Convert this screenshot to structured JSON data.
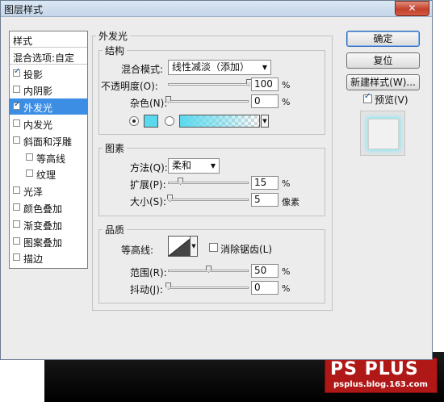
{
  "window": {
    "title": "图层样式",
    "close_icon": "close-icon"
  },
  "style_list": {
    "header": "样式",
    "blend_options": "混合选项:自定",
    "items": [
      {
        "label": "投影",
        "checked": true
      },
      {
        "label": "内阴影",
        "checked": false
      },
      {
        "label": "外发光",
        "checked": true,
        "selected": true
      },
      {
        "label": "内发光",
        "checked": false
      },
      {
        "label": "斜面和浮雕",
        "checked": false
      },
      {
        "label": "等高线",
        "checked": false,
        "indent": true
      },
      {
        "label": "纹理",
        "checked": false,
        "indent": true
      },
      {
        "label": "光泽",
        "checked": false
      },
      {
        "label": "颜色叠加",
        "checked": false
      },
      {
        "label": "渐变叠加",
        "checked": false
      },
      {
        "label": "图案叠加",
        "checked": false
      },
      {
        "label": "描边",
        "checked": false
      }
    ]
  },
  "outer_glow": {
    "title": "外发光",
    "structure": {
      "title": "结构",
      "blend_mode_label": "混合模式:",
      "blend_mode_value": "线性减淡（添加）",
      "opacity_label": "不透明度(O):",
      "opacity_value": "100",
      "opacity_level": 1.0,
      "noise_label": "杂色(N):",
      "noise_value": "0",
      "noise_level": 0.0,
      "percent": "%",
      "glow_color": "#5ad9ee"
    },
    "elements": {
      "title": "图素",
      "technique_label": "方法(Q):",
      "technique_value": "柔和",
      "spread_label": "扩展(P):",
      "spread_value": "15",
      "spread_level": 0.15,
      "size_label": "大小(S):",
      "size_value": "5",
      "size_unit": "像素",
      "size_level": 0.02,
      "percent": "%"
    },
    "quality": {
      "title": "品质",
      "contour_label": "等高线:",
      "anti_alias_label": "消除锯齿(L)",
      "anti_alias_checked": false,
      "range_label": "范围(R):",
      "range_value": "50",
      "range_level": 0.5,
      "jitter_label": "抖动(J):",
      "jitter_value": "0",
      "jitter_level": 0.0,
      "percent": "%"
    }
  },
  "buttons": {
    "ok": "确定",
    "reset": "复位",
    "new_style": "新建样式(W)...",
    "preview_label": "预览(V)",
    "preview_checked": true
  },
  "watermark": {
    "brand": "PS PLUS",
    "site": "psplus.blog.163.com"
  }
}
